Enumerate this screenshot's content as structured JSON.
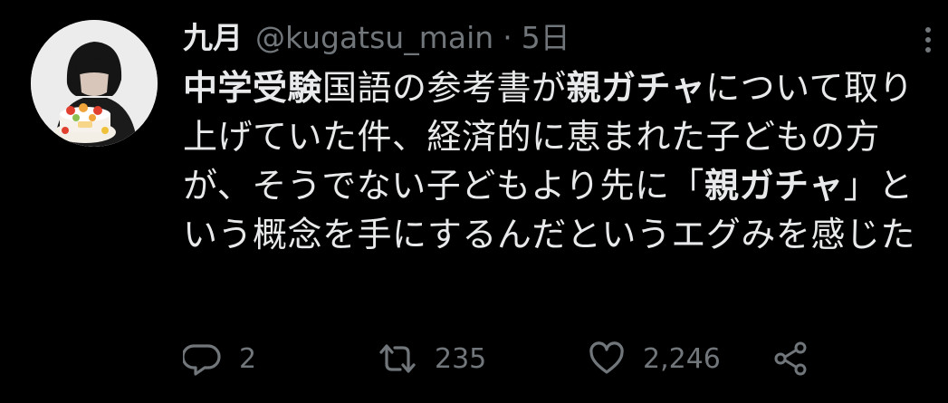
{
  "tweet": {
    "author_name": "九月",
    "author_handle": "@kugatsu_main",
    "separator": "·",
    "time": "5日",
    "body": [
      {
        "t": "中学受験",
        "b": true
      },
      {
        "t": "国語の参考書が",
        "b": false
      },
      {
        "t": "親ガチャ",
        "b": true
      },
      {
        "t": "について取り上げていた件、経済的に恵まれた子どもの方が、そうでない子どもより先に「",
        "b": false
      },
      {
        "t": "親ガチャ",
        "b": true
      },
      {
        "t": "」という概念を手にするんだというエグみを感じた",
        "b": false
      }
    ],
    "reply_count": "2",
    "retweet_count": "235",
    "like_count": "2,246"
  },
  "colors": {
    "background": "#000000",
    "text": "#e7e9ea",
    "muted": "#71767b"
  },
  "icons": [
    "avatar",
    "more-icon",
    "reply-icon",
    "retweet-icon",
    "like-icon",
    "share-icon"
  ]
}
